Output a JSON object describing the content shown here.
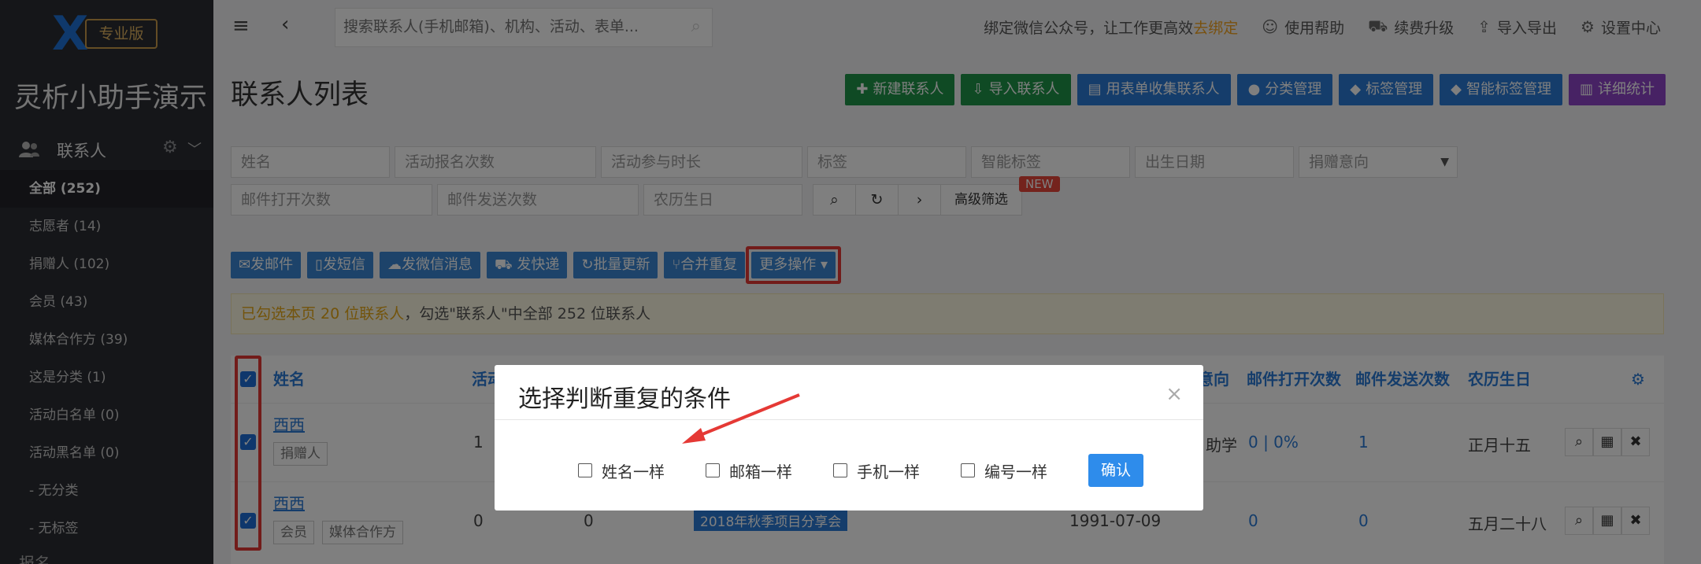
{
  "sidebar": {
    "logo_badge": "专业版",
    "brand": "灵析小助手演示",
    "section_label": "联系人",
    "items": [
      {
        "label": "全部 (252)",
        "active": true
      },
      {
        "label": "志愿者 (14)"
      },
      {
        "label": "捐赠人 (102)"
      },
      {
        "label": "会员 (43)"
      },
      {
        "label": "媒体合作方 (39)"
      },
      {
        "label": "这是分类 (1)"
      },
      {
        "label": "活动白名单 (0)"
      },
      {
        "label": "活动黑名单 (0)"
      },
      {
        "label": "- 无分类"
      },
      {
        "label": "- 无标签"
      }
    ],
    "next_section": "报名"
  },
  "topbar": {
    "search_placeholder": "搜索联系人(手机邮箱)、机构、活动、表单...",
    "promo_text": "绑定微信公众号，让工作更高效",
    "promo_link": "去绑定",
    "help": "使用帮助",
    "upgrade": "续费升级",
    "import_export": "导入导出",
    "settings": "设置中心"
  },
  "page": {
    "title": "联系人列表",
    "actions": [
      "新建联系人",
      "导入联系人",
      "用表单收集联系人",
      "分类管理",
      "标签管理",
      "智能标签管理",
      "详细统计"
    ]
  },
  "filters": {
    "row1": [
      "姓名",
      "活动报名次数",
      "活动参与时长",
      "标签",
      "智能标签",
      "出生日期",
      "捐赠意向"
    ],
    "row2": [
      "邮件打开次数",
      "邮件发送次数",
      "农历生日"
    ],
    "advanced": "高级筛选",
    "new_badge": "NEW"
  },
  "toolbar": {
    "buttons": [
      "发邮件",
      "发短信",
      "发微信消息",
      "发快递",
      "批量更新",
      "合并重复"
    ],
    "more": "更多操作"
  },
  "notice": {
    "selected": "已勾选本页 20 位联系人",
    "rest": "，勾选\"联系人\"中全部 252 位联系人"
  },
  "table": {
    "headers": {
      "name": "姓名",
      "activity": "活动",
      "intent": "意向",
      "open": "邮件打开次数",
      "sent": "邮件发送次数",
      "lunar": "农历生日"
    },
    "rows": [
      {
        "name": "西西",
        "tags": [
          "捐赠人"
        ],
        "activity": "1",
        "intent": "助学",
        "open": "0 | 0%",
        "sent": "1",
        "lunar": "正月十五"
      },
      {
        "name": "西西",
        "tags": [
          "会员",
          "媒体合作方"
        ],
        "activity": "0",
        "count": "0",
        "event": "2018年秋季项目分享会",
        "birth": "1991-07-09",
        "open": "0",
        "sent": "0",
        "lunar": "五月二十八"
      }
    ]
  },
  "modal": {
    "title": "选择判断重复的条件",
    "options": [
      "姓名一样",
      "邮箱一样",
      "手机一样",
      "编号一样"
    ],
    "confirm": "确认"
  },
  "colors": {
    "highlight": "#e53935",
    "primary": "#2b7bd6",
    "green": "#1e9448",
    "purple": "#8e44c9",
    "sidebar": "#2b2d33"
  }
}
